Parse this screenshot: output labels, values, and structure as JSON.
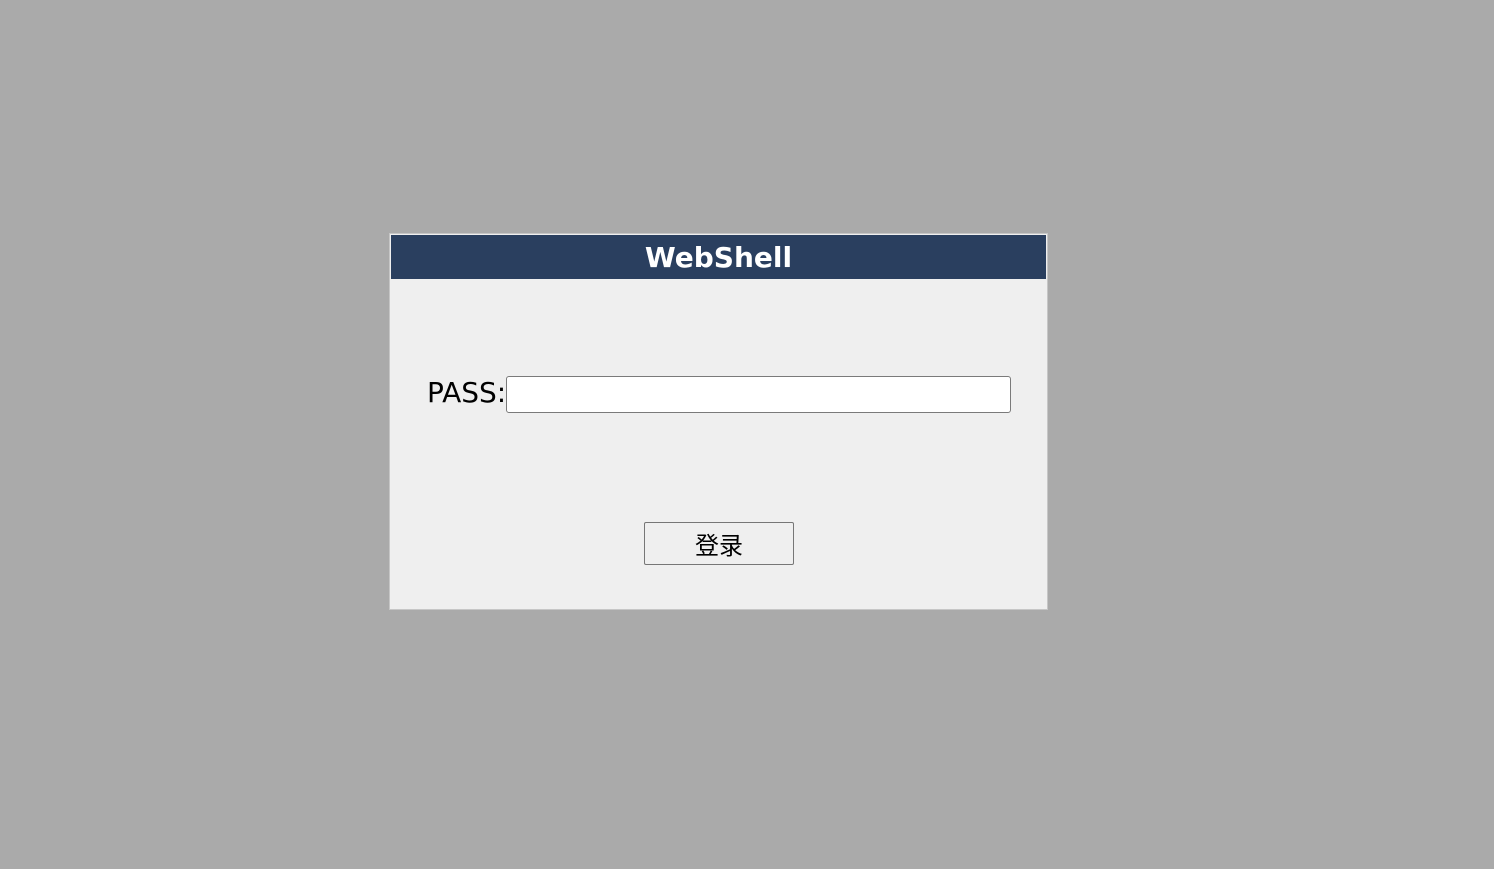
{
  "dialog": {
    "title": "WebShell",
    "pass_label": "PASS:",
    "pass_value": "",
    "login_label": "登录"
  },
  "colors": {
    "background": "#aaaaaa",
    "dialog_background": "#efefef",
    "title_bar": "#2a3f5f",
    "title_text": "#ffffff"
  }
}
